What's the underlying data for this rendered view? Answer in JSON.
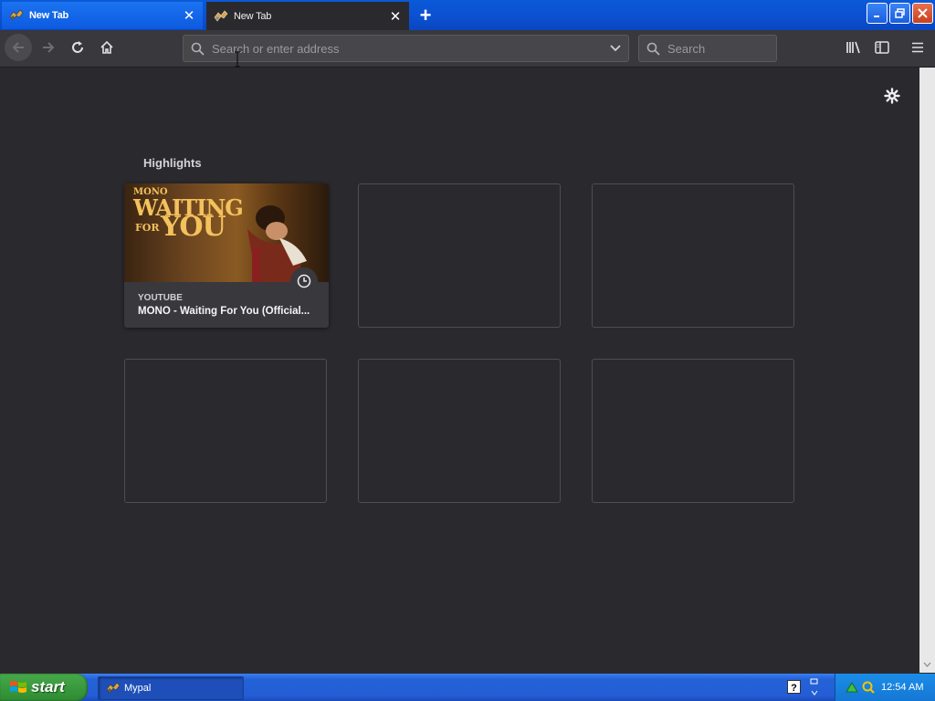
{
  "tabs": [
    {
      "title": "New Tab",
      "active": false
    },
    {
      "title": "New Tab",
      "active": true
    }
  ],
  "toolbar": {
    "address_placeholder": "Search or enter address",
    "search_placeholder": "Search"
  },
  "highlights": {
    "title": "Highlights",
    "cards": [
      {
        "source": "YOUTUBE",
        "title": "MONO - Waiting For You (Official...",
        "thumbnail_text": [
          "MONO",
          "WAITING",
          "FOR",
          "YOU"
        ]
      }
    ]
  },
  "taskbar": {
    "start_label": "start",
    "window_label": "Mypal",
    "clock": "12:54 AM"
  },
  "colors": {
    "content_bg": "#2a2a2e",
    "toolbar_bg": "#38383d",
    "titlebar_blue": "#0c4fd0",
    "start_green": "#3a9a3e"
  }
}
